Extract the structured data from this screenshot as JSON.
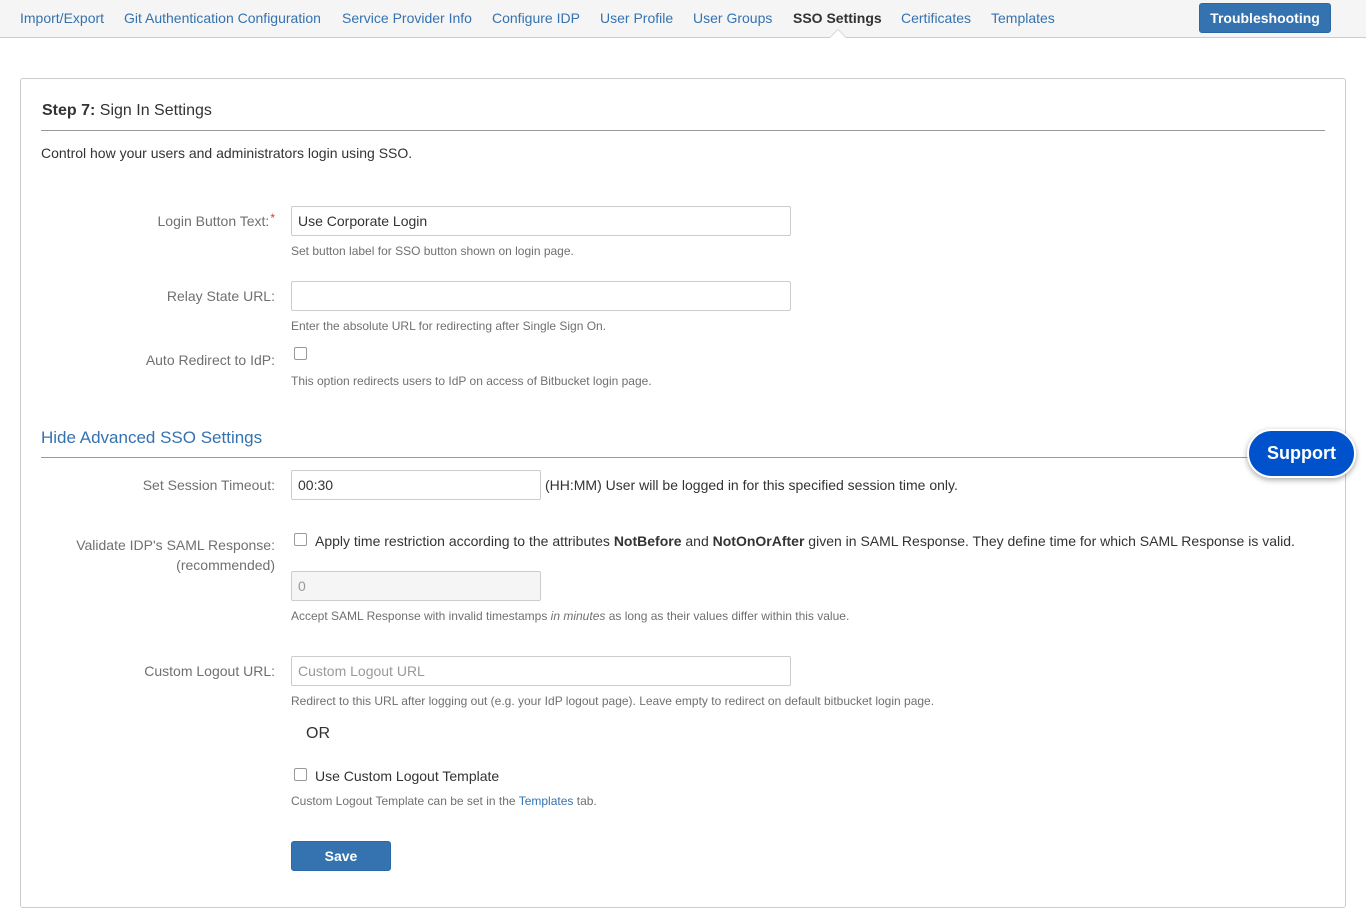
{
  "nav": {
    "tabs": [
      {
        "label": "Import/Export"
      },
      {
        "label": "Git Authentication Configuration"
      },
      {
        "label": "Service Provider Info"
      },
      {
        "label": "Configure IDP"
      },
      {
        "label": "User Profile"
      },
      {
        "label": "User Groups"
      },
      {
        "label": "SSO Settings",
        "active": true
      },
      {
        "label": "Certificates"
      },
      {
        "label": "Templates"
      }
    ],
    "troubleshooting_label": "Troubleshooting"
  },
  "step": {
    "prefix": "Step 7:",
    "title": "Sign In Settings",
    "description": "Control how your users and administrators login using SSO."
  },
  "login_button": {
    "label": "Login Button Text:",
    "required_mark": "*",
    "value": "Use Corporate Login",
    "help": "Set button label for SSO button shown on login page."
  },
  "relay_state": {
    "label": "Relay State URL:",
    "value": "",
    "help": "Enter the absolute URL for redirecting after Single Sign On."
  },
  "auto_redirect": {
    "label": "Auto Redirect to IdP:",
    "checked": false,
    "help": "This option redirects users to IdP on access of Bitbucket login page."
  },
  "advanced": {
    "toggle_label": "Hide Advanced SSO Settings"
  },
  "session_timeout": {
    "label": "Set Session Timeout:",
    "value": "00:30",
    "suffix": "(HH:MM) User will be logged in for this specified session time only."
  },
  "validate_saml": {
    "label_line1": "Validate IDP's SAML Response:",
    "label_line2": "(recommended)",
    "checked": false,
    "text_before": "Apply time restriction according to the attributes ",
    "attr1": "NotBefore",
    "text_mid": " and ",
    "attr2": "NotOnOrAfter",
    "text_after": " given in SAML Response. They define time for which SAML Response is valid.",
    "minutes_value": "0",
    "help_before": "Accept SAML Response with invalid timestamps ",
    "help_italic": "in minutes",
    "help_after": " as long as their values differ within this value."
  },
  "custom_logout": {
    "label": "Custom Logout URL:",
    "value": "",
    "placeholder": "Custom Logout URL",
    "help": "Redirect to this URL after logging out (e.g. your IdP logout page). Leave empty to redirect on default bitbucket login page.",
    "or_text": "OR",
    "template_checkbox_label": "Use Custom Logout Template",
    "template_checked": false,
    "template_help_before": "Custom Logout Template can be set in the ",
    "template_help_link": "Templates",
    "template_help_after": " tab."
  },
  "save_label": "Save",
  "support_label": "Support",
  "colors": {
    "link": "#3572b0",
    "primary_button": "#3572b0",
    "support_button": "#0052cc",
    "required": "#d04437",
    "muted_text": "#707070"
  }
}
